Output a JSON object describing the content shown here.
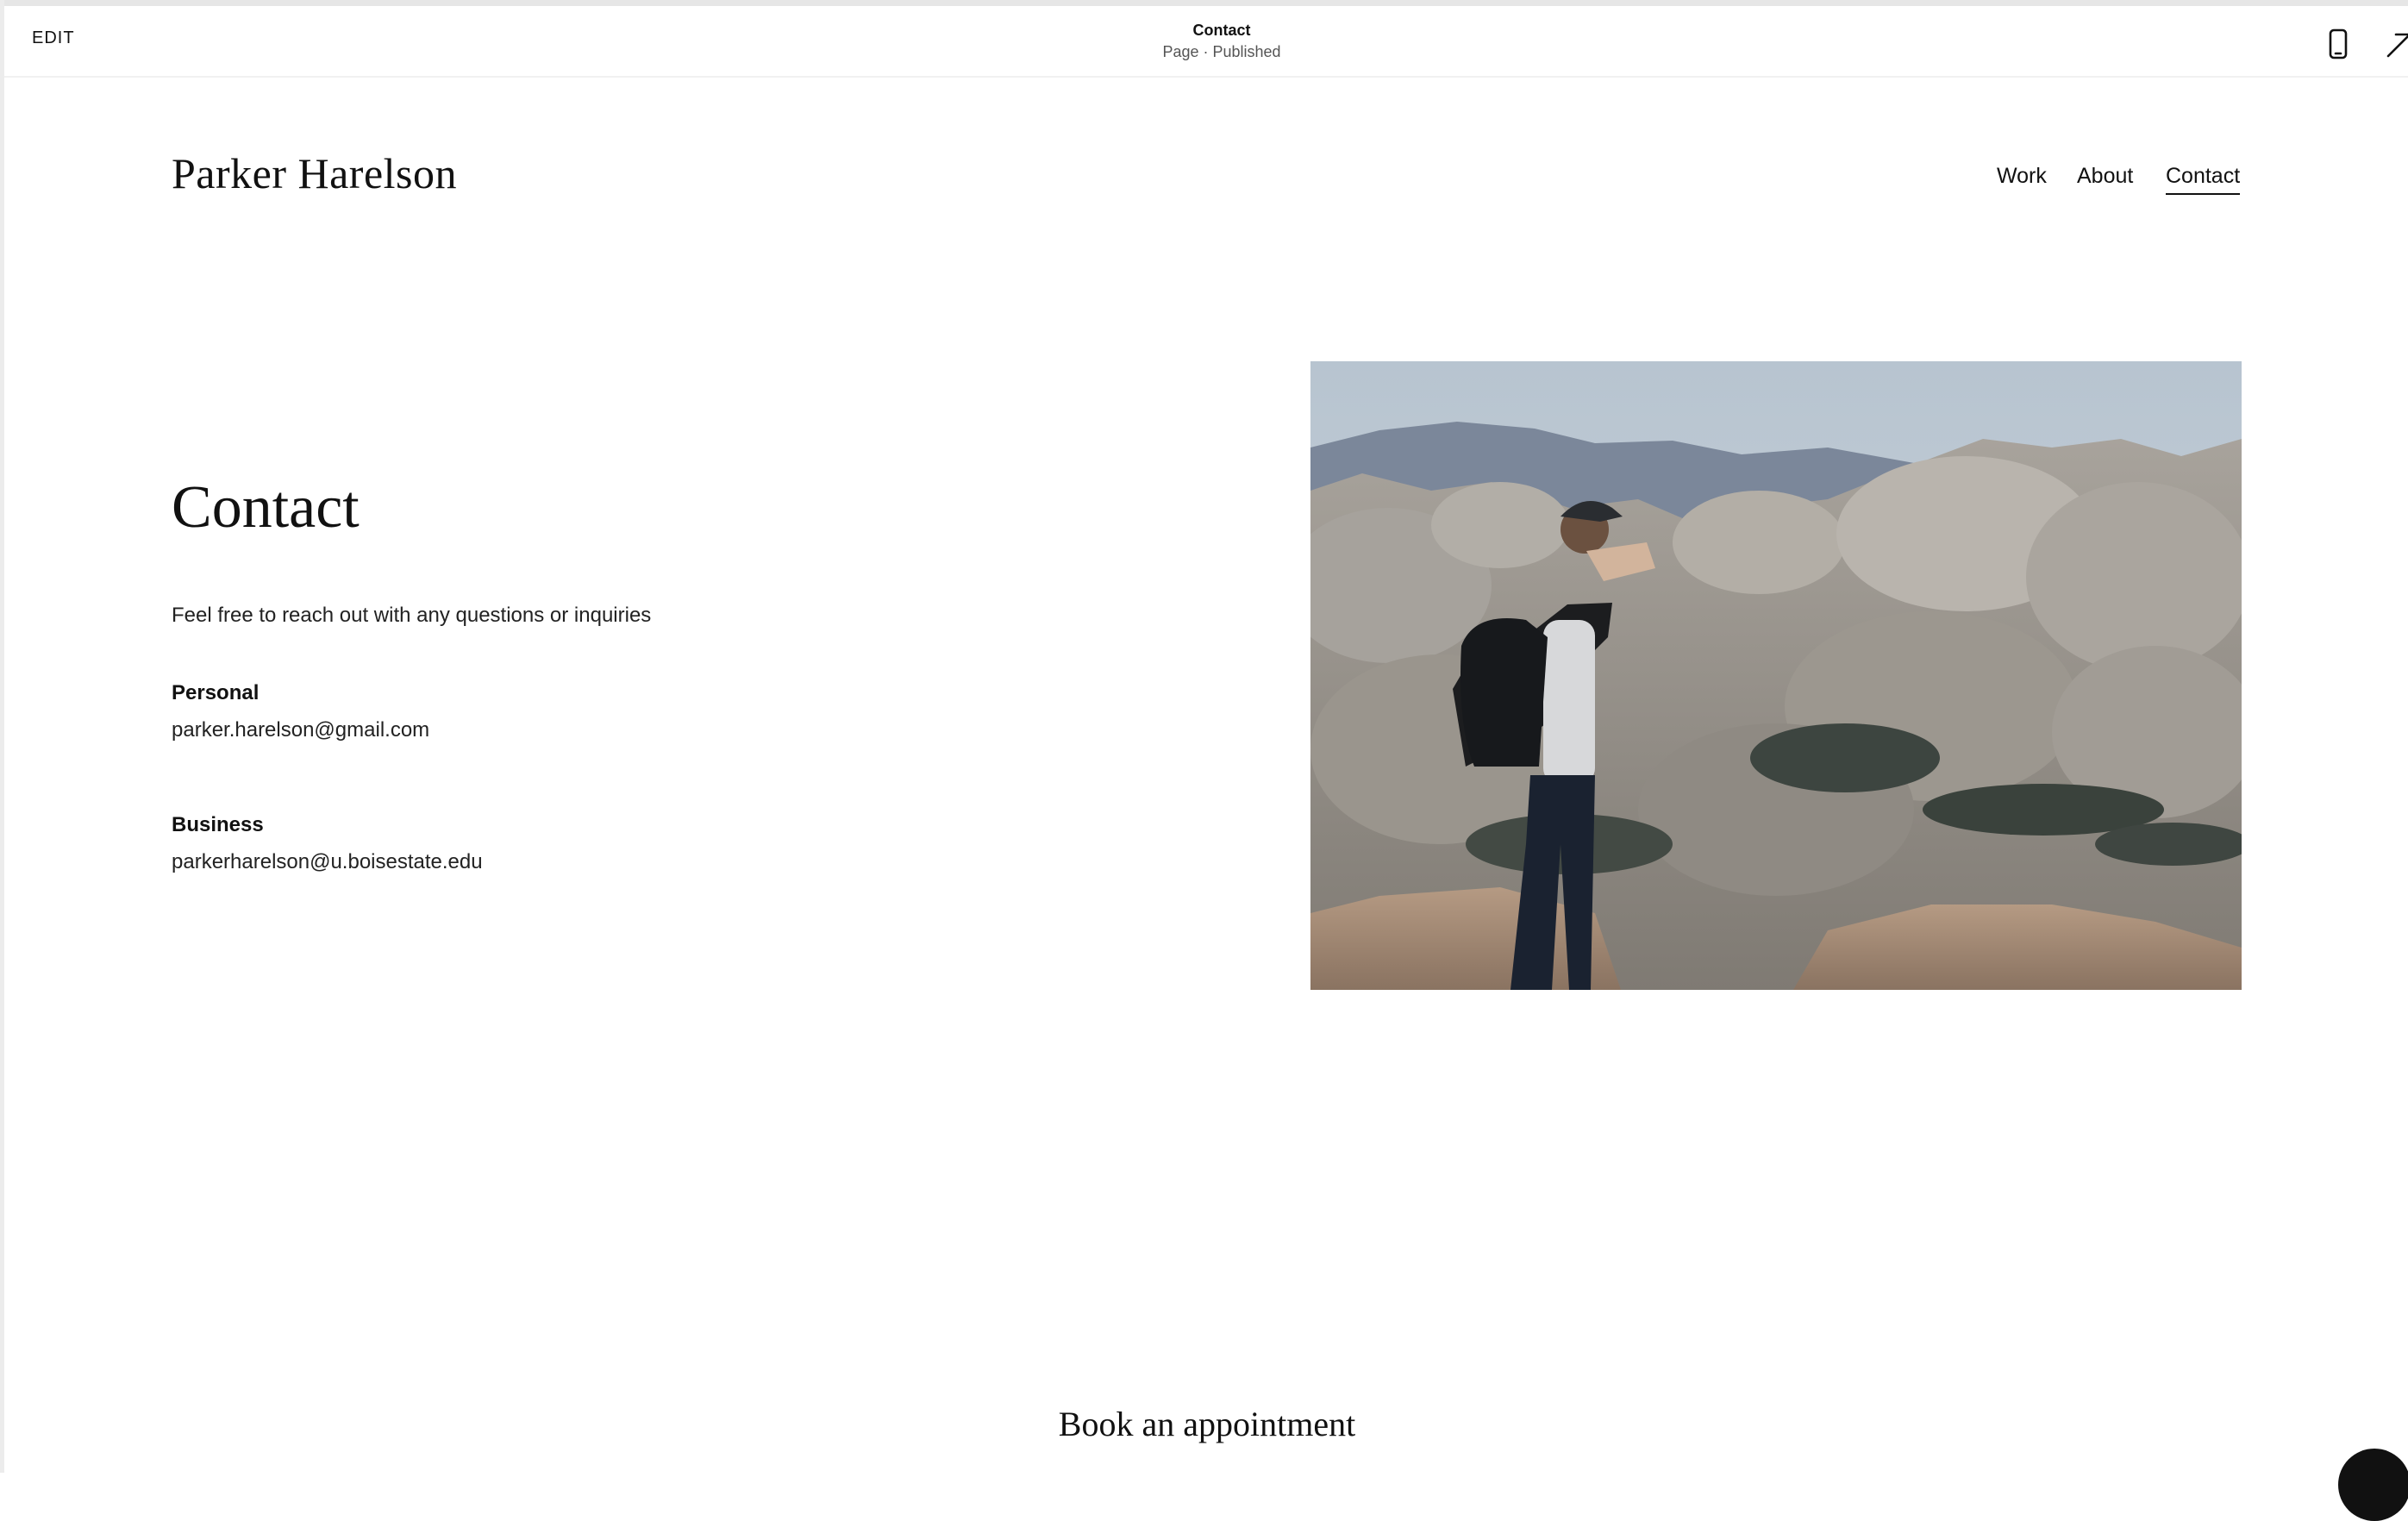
{
  "editor": {
    "edit_label": "EDIT",
    "page_title": "Contact",
    "page_status": "Page · Published",
    "icons": [
      "mobile-preview-icon",
      "exit-arrow-icon"
    ]
  },
  "site": {
    "title": "Parker Harelson",
    "nav": [
      {
        "label": "Work",
        "active": false
      },
      {
        "label": "About",
        "active": false
      },
      {
        "label": "Contact",
        "active": true
      }
    ]
  },
  "contact": {
    "heading": "Contact",
    "intro": "Feel free to reach out with any questions or inquiries",
    "personal": {
      "label": "Personal",
      "email": "parker.harelson@gmail.com"
    },
    "business": {
      "label": "Business",
      "email": "parkerharelson@u.boisestate.edu"
    }
  },
  "booking": {
    "heading": "Book an appointment"
  },
  "colors": {
    "text": "#111111",
    "background": "#ffffff",
    "accent": "#111111"
  }
}
